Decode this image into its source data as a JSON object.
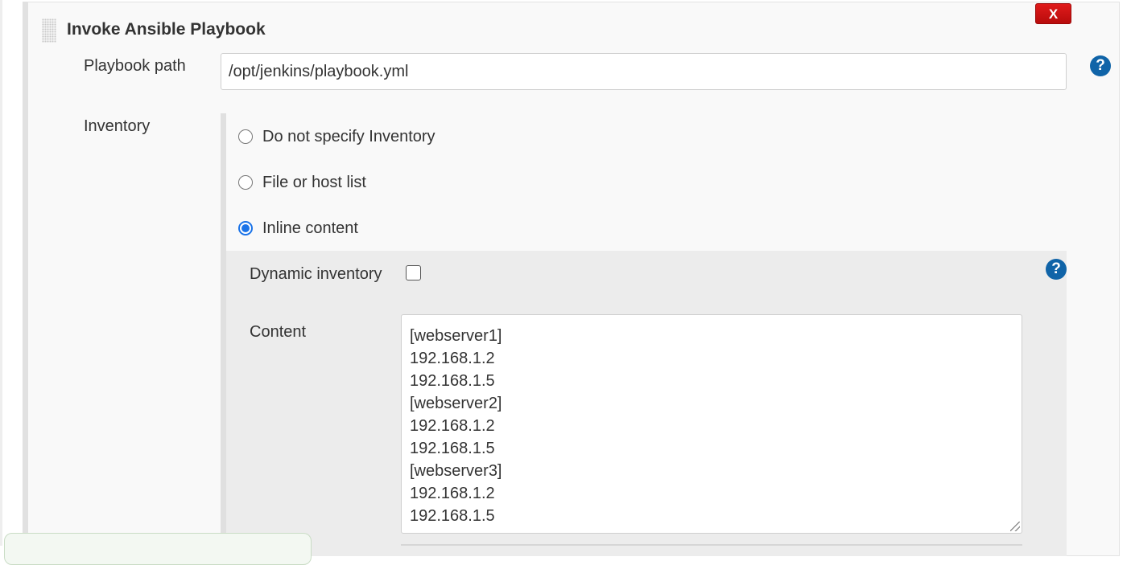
{
  "step": {
    "title": "Invoke Ansible Playbook",
    "delete_label": "X"
  },
  "playbook": {
    "label": "Playbook path",
    "value": "/opt/jenkins/playbook.yml",
    "help_icon": "question-mark-icon"
  },
  "inventory": {
    "label": "Inventory",
    "options": [
      {
        "label": "Do not specify Inventory",
        "selected": false
      },
      {
        "label": "File or host list",
        "selected": false
      },
      {
        "label": "Inline content",
        "selected": true
      }
    ],
    "dynamic_label": "Dynamic inventory",
    "dynamic_checked": false,
    "content_label": "Content",
    "content_lines": [
      "[webserver1]",
      "192.168.1.2",
      "192.168.1.5",
      "[webserver2]",
      "192.168.1.2",
      "192.168.1.5",
      "[webserver3]",
      "192.168.1.2",
      "192.168.1.5"
    ]
  },
  "colors": {
    "help_icon": "#1064a8",
    "delete_button": "#d01414",
    "radio_selected": "#1a73e8"
  }
}
